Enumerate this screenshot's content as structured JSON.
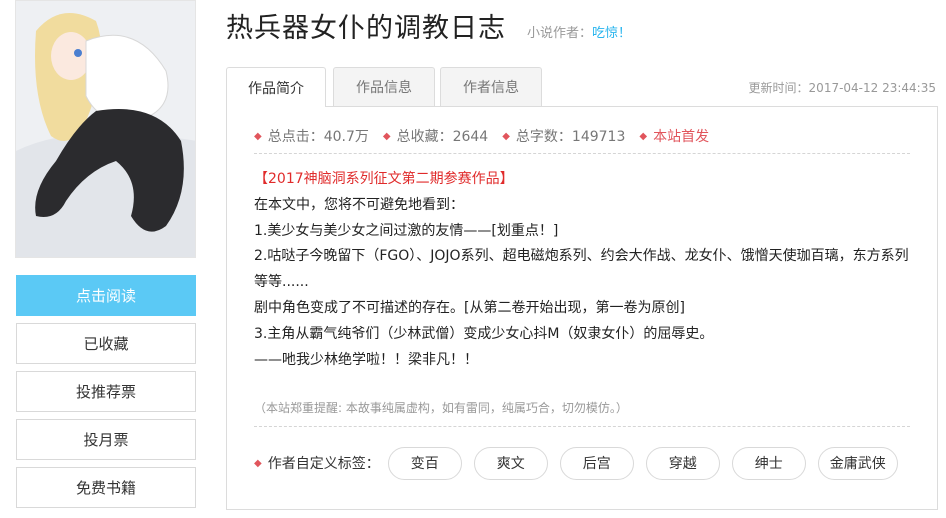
{
  "book": {
    "title": "热兵器女仆的调教日志",
    "author_label": "小说作者：",
    "author_name": "吃惊！"
  },
  "sidebar": {
    "buttons": [
      {
        "label": "点击阅读"
      },
      {
        "label": "已收藏"
      },
      {
        "label": "投推荐票"
      },
      {
        "label": "投月票"
      },
      {
        "label": "免费书籍"
      }
    ]
  },
  "tabs": [
    {
      "label": "作品简介",
      "active": true
    },
    {
      "label": "作品信息",
      "active": false
    },
    {
      "label": "作者信息",
      "active": false
    }
  ],
  "update_time": "更新时间：2017-04-12 23:44:35",
  "stats": {
    "clicks": "总点击：40.7万",
    "favorites": "总收藏：2644",
    "words": "总字数：149713",
    "first_release": "本站首发"
  },
  "intro": {
    "line1": "【2017神脑洞系列征文第二期参赛作品】",
    "line2": "在本文中，您将不可避免地看到：",
    "line3": "1.美少女与美少女之间过激的友情——[划重点！]",
    "line4": "2.咕哒子今晚留下（FGO）、JOJO系列、超电磁炮系列、约会大作战、龙女仆、饿憎天使珈百璃，东方系列等等......",
    "line5": "剧中角色变成了不可描述的存在。[从第二卷开始出现，第一卷为原创]",
    "line6": "3.主角从霸气纯爷们（少林武僧）变成少女心抖M（奴隶女仆）的屈辱史。",
    "line7": "——吔我少林绝学啦！！梁非凡！！"
  },
  "notice": "（本站郑重提醒: 本故事纯属虚构，如有雷同，纯属巧合，切勿模仿。）",
  "tags": {
    "label": "作者自定义标签：",
    "items": [
      "变百",
      "爽文",
      "后宫",
      "穿越",
      "绅士",
      "金庸武侠"
    ]
  },
  "colors": {
    "accent": "#5bc9f5",
    "link": "#27b4ee",
    "highlight_red": "#e02b2b",
    "dot_red": "#e1555c"
  }
}
